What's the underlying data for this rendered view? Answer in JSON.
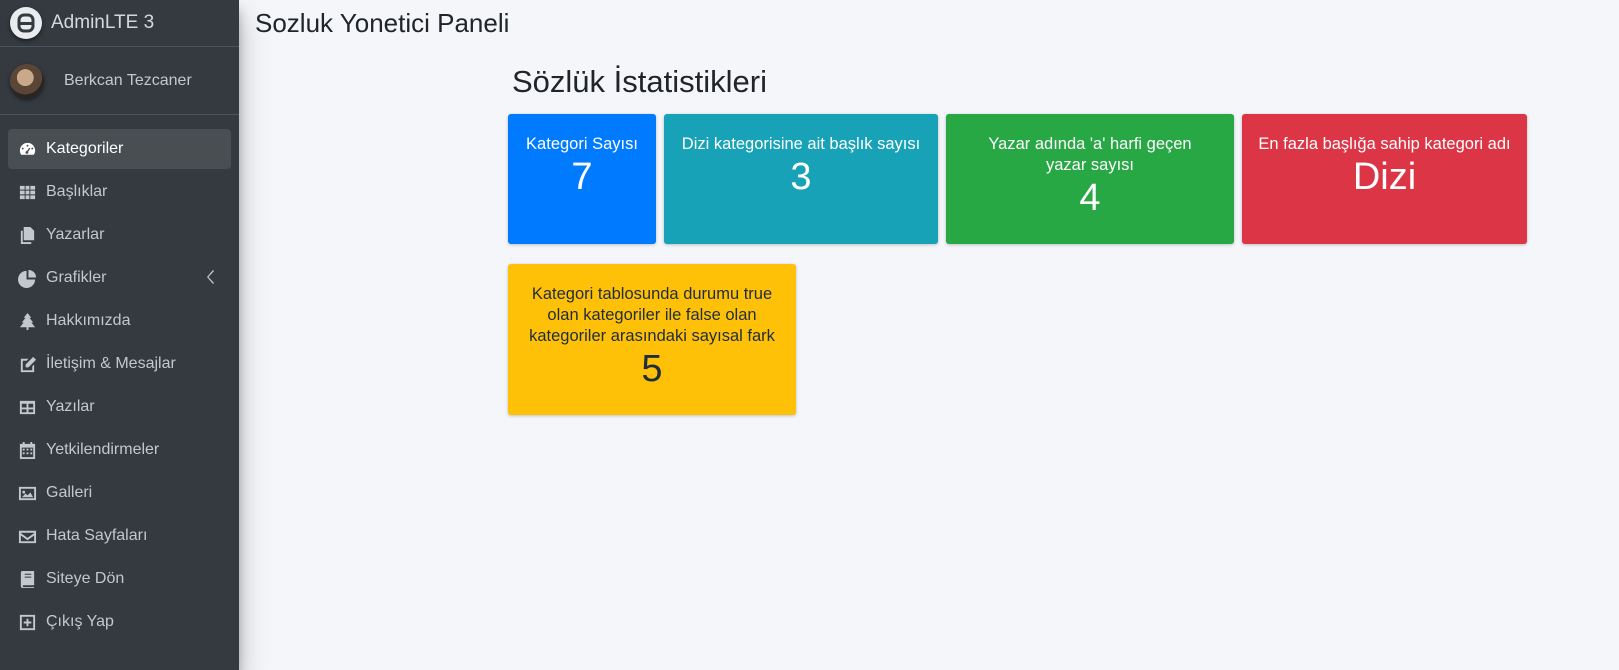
{
  "brand": {
    "name": "AdminLTE 3"
  },
  "user": {
    "name": "Berkcan Tezcaner"
  },
  "sidebar": {
    "items": [
      {
        "label": "Kategoriler",
        "icon": "tachometer-icon",
        "active": true
      },
      {
        "label": "Başlıklar",
        "icon": "grid-icon"
      },
      {
        "label": "Yazarlar",
        "icon": "copy-icon"
      },
      {
        "label": "Grafikler",
        "icon": "pie-chart-icon",
        "has_children": true
      },
      {
        "label": "Hakkımızda",
        "icon": "tree-icon"
      },
      {
        "label": "İletişim & Mesajlar",
        "icon": "edit-icon"
      },
      {
        "label": "Yazılar",
        "icon": "table-icon"
      },
      {
        "label": "Yetkilendirmeler",
        "icon": "calendar-icon"
      },
      {
        "label": "Galleri",
        "icon": "image-icon"
      },
      {
        "label": "Hata Sayfaları",
        "icon": "envelope-icon"
      },
      {
        "label": "Siteye Dön",
        "icon": "book-icon"
      },
      {
        "label": "Çıkış Yap",
        "icon": "plus-square-icon"
      }
    ]
  },
  "header": {
    "title": "Sozluk Yonetici Paneli"
  },
  "main": {
    "section_title": "Sözlük İstatistikleri",
    "cards": [
      {
        "label": "Kategori Sayısı",
        "value": "7",
        "color": "#007bff"
      },
      {
        "label": "Dizi kategorisine ait başlık sayısı",
        "value": "3",
        "color": "#17a2b8"
      },
      {
        "label": "Yazar adında 'a' harfi geçen yazar sayısı",
        "value": "4",
        "color": "#28a745"
      },
      {
        "label": "En fazla başlığa sahip kategori adı",
        "value": "Dizi",
        "color": "#dc3545"
      },
      {
        "label": "Kategori tablosunda durumu true olan kategoriler ile false olan kategoriler arasındaki sayısal fark",
        "value": "5",
        "color": "#ffc107"
      }
    ]
  }
}
